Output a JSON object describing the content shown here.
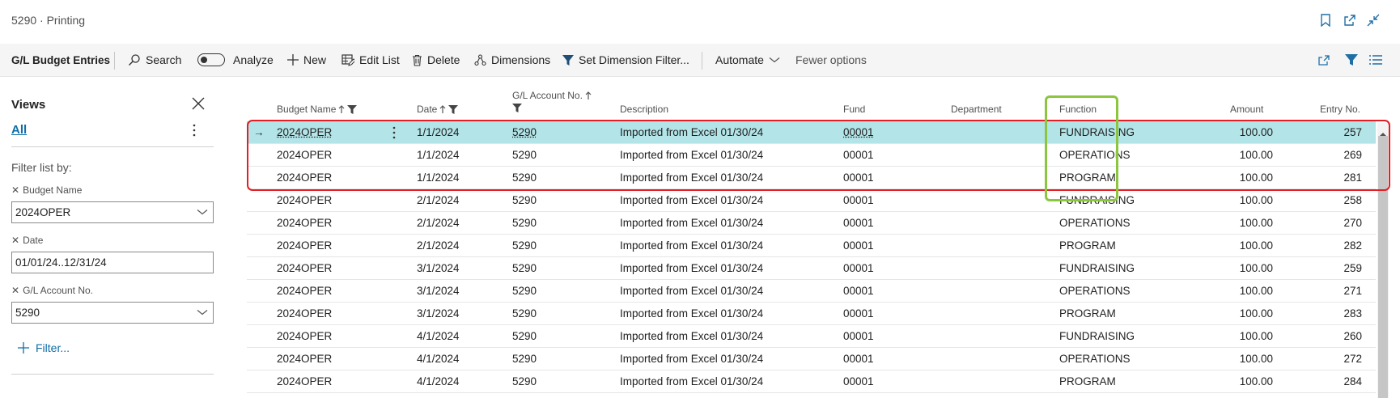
{
  "window": {
    "title": "5290 · Printing"
  },
  "actionbar": {
    "page_name": "G/L Budget Entries",
    "search": "Search",
    "analyze": "Analyze",
    "new": "New",
    "edit_list": "Edit List",
    "delete": "Delete",
    "dimensions": "Dimensions",
    "set_dimension_filter": "Set Dimension Filter...",
    "automate": "Automate",
    "fewer_options": "Fewer options"
  },
  "views": {
    "title": "Views",
    "all": "All"
  },
  "filters": {
    "title": "Filter list by:",
    "items": [
      {
        "label": "Budget Name",
        "value": "2024OPER"
      },
      {
        "label": "Date",
        "value": "01/01/24..12/31/24"
      },
      {
        "label": "G/L Account No.",
        "value": "5290"
      }
    ],
    "add": "Filter..."
  },
  "table": {
    "columns": [
      "Budget Name",
      "Date",
      "G/L Account No.",
      "Description",
      "Fund",
      "Department",
      "Function",
      "Amount",
      "Entry No."
    ],
    "rows": [
      {
        "budget": "2024OPER",
        "date": "1/1/2024",
        "account": "5290",
        "description": "Imported from Excel 01/30/24",
        "fund": "00001",
        "department": "",
        "function": "FUNDRAISING",
        "amount": "100.00",
        "entry": "257"
      },
      {
        "budget": "2024OPER",
        "date": "1/1/2024",
        "account": "5290",
        "description": "Imported from Excel 01/30/24",
        "fund": "00001",
        "department": "",
        "function": "OPERATIONS",
        "amount": "100.00",
        "entry": "269"
      },
      {
        "budget": "2024OPER",
        "date": "1/1/2024",
        "account": "5290",
        "description": "Imported from Excel 01/30/24",
        "fund": "00001",
        "department": "",
        "function": "PROGRAM",
        "amount": "100.00",
        "entry": "281"
      },
      {
        "budget": "2024OPER",
        "date": "2/1/2024",
        "account": "5290",
        "description": "Imported from Excel 01/30/24",
        "fund": "00001",
        "department": "",
        "function": "FUNDRAISING",
        "amount": "100.00",
        "entry": "258"
      },
      {
        "budget": "2024OPER",
        "date": "2/1/2024",
        "account": "5290",
        "description": "Imported from Excel 01/30/24",
        "fund": "00001",
        "department": "",
        "function": "OPERATIONS",
        "amount": "100.00",
        "entry": "270"
      },
      {
        "budget": "2024OPER",
        "date": "2/1/2024",
        "account": "5290",
        "description": "Imported from Excel 01/30/24",
        "fund": "00001",
        "department": "",
        "function": "PROGRAM",
        "amount": "100.00",
        "entry": "282"
      },
      {
        "budget": "2024OPER",
        "date": "3/1/2024",
        "account": "5290",
        "description": "Imported from Excel 01/30/24",
        "fund": "00001",
        "department": "",
        "function": "FUNDRAISING",
        "amount": "100.00",
        "entry": "259"
      },
      {
        "budget": "2024OPER",
        "date": "3/1/2024",
        "account": "5290",
        "description": "Imported from Excel 01/30/24",
        "fund": "00001",
        "department": "",
        "function": "OPERATIONS",
        "amount": "100.00",
        "entry": "271"
      },
      {
        "budget": "2024OPER",
        "date": "3/1/2024",
        "account": "5290",
        "description": "Imported from Excel 01/30/24",
        "fund": "00001",
        "department": "",
        "function": "PROGRAM",
        "amount": "100.00",
        "entry": "283"
      },
      {
        "budget": "2024OPER",
        "date": "4/1/2024",
        "account": "5290",
        "description": "Imported from Excel 01/30/24",
        "fund": "00001",
        "department": "",
        "function": "FUNDRAISING",
        "amount": "100.00",
        "entry": "260"
      },
      {
        "budget": "2024OPER",
        "date": "4/1/2024",
        "account": "5290",
        "description": "Imported from Excel 01/30/24",
        "fund": "00001",
        "department": "",
        "function": "OPERATIONS",
        "amount": "100.00",
        "entry": "272"
      },
      {
        "budget": "2024OPER",
        "date": "4/1/2024",
        "account": "5290",
        "description": "Imported from Excel 01/30/24",
        "fund": "00001",
        "department": "",
        "function": "PROGRAM",
        "amount": "100.00",
        "entry": "284"
      }
    ]
  },
  "colors": {
    "accent": "#0e6ea8",
    "selected_row": "#b2e4e8",
    "highlight_red": "#e31e24",
    "highlight_green": "#8cc63f"
  }
}
